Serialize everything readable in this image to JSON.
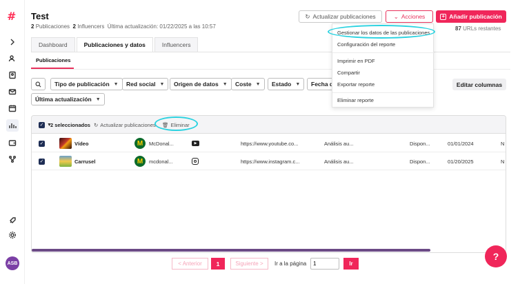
{
  "header": {
    "title": "Test",
    "pub_count": "2",
    "pub_label": "Publicaciones",
    "inf_count": "2",
    "inf_label": "Influencers",
    "updated": "Última actualización: 01/22/2025 a las 10:57",
    "refresh_label": "Actualizar publicaciones",
    "actions_label": "Acciones",
    "add_label": "Añadir publicación",
    "urls_count": "87",
    "urls_label": "URLs restantes"
  },
  "tabs": [
    {
      "label": "Dashboard"
    },
    {
      "label": "Publicaciones y datos"
    },
    {
      "label": "Influencers"
    }
  ],
  "subtab": "Publicaciones",
  "filters": [
    {
      "label": "Tipo de publicación"
    },
    {
      "label": "Red social"
    },
    {
      "label": "Origen de datos"
    },
    {
      "label": "Coste"
    },
    {
      "label": "Estado"
    },
    {
      "label": "Fecha de"
    },
    {
      "label": "Última actualización"
    }
  ],
  "edit_columns": "Editar columnas",
  "menu": {
    "items": [
      {
        "label": "Gestionar los datos de las publicaciones"
      },
      {
        "label": "Configuración del reporte"
      },
      {
        "label": "Imprimir en PDF"
      },
      {
        "label": "Compartir"
      },
      {
        "label": "Exportar reporte"
      },
      {
        "label": "Eliminar reporte"
      }
    ]
  },
  "table": {
    "selected": "2 seleccionados",
    "refresh": "Actualizar publicaciones",
    "delete": "Eliminar",
    "rows": [
      {
        "name": "Vídeo",
        "account": "McDonal...",
        "network": "youtube",
        "url": "https://www.youtube.co...",
        "analysis": "Análisis au...",
        "status": "Dispon...",
        "date": "01/01/2024",
        "extra": "N"
      },
      {
        "name": "Carrusel",
        "account": "mcdonal...",
        "network": "instagram",
        "url": "https://www.instagram.c...",
        "analysis": "Análisis au...",
        "status": "Dispon...",
        "date": "01/20/2025",
        "extra": "N"
      }
    ]
  },
  "pager": {
    "prev": "< Anterior",
    "page": "1",
    "next": "Siguiente >",
    "goto_label": "Ir a la página",
    "goto_value": "1",
    "go": "Ir"
  },
  "user": {
    "initials": "ASB"
  },
  "colors": {
    "accent": "#f0265a",
    "highlight": "#2ad2e0",
    "checkbox": "#1e2d54"
  }
}
